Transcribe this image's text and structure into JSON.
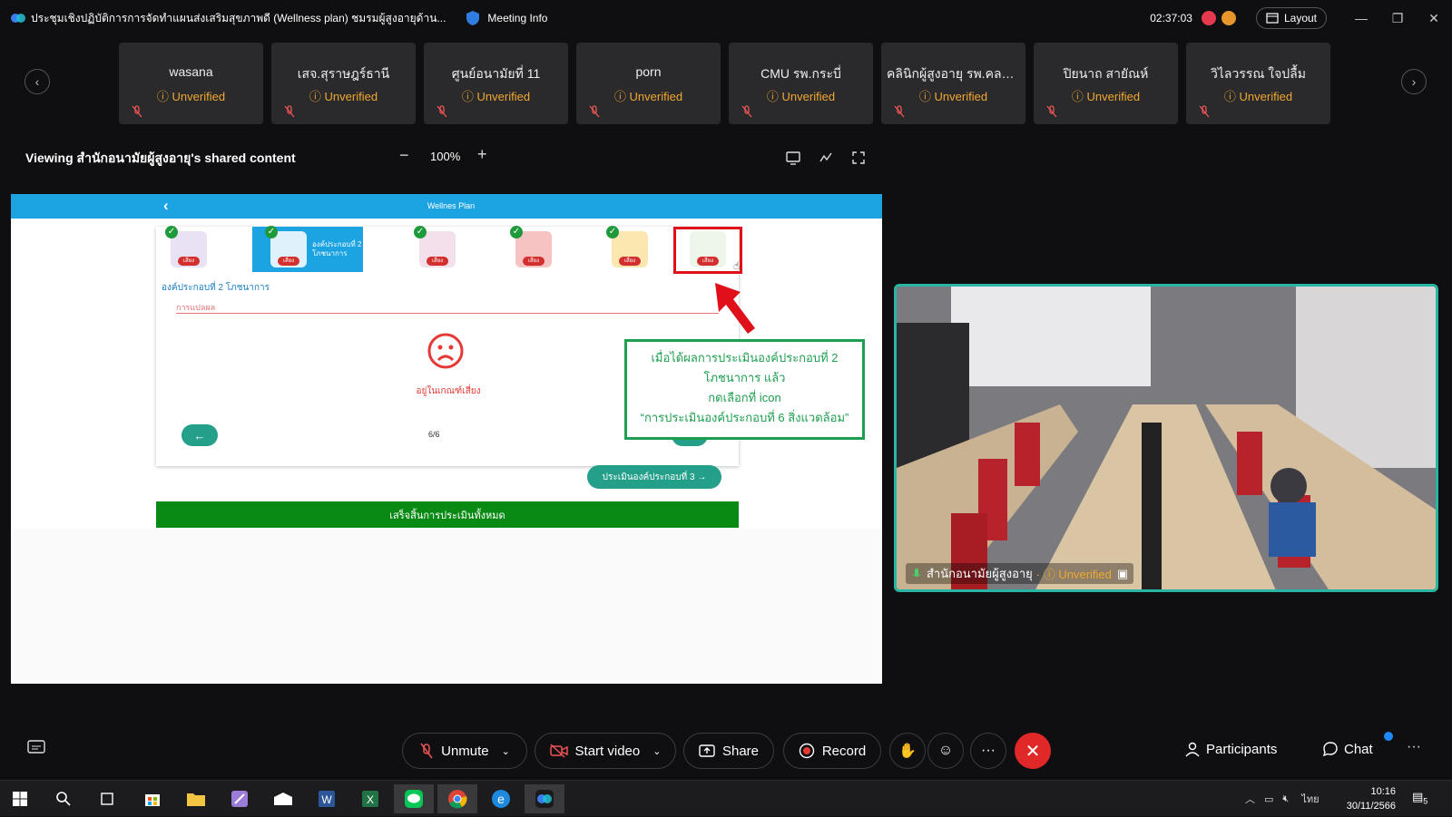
{
  "window": {
    "title": "ประชุมเชิงปฏิบัติการการจัดทำแผนส่งเสริมสุขภาพดี (Wellness plan) ชมรมผู้สูงอายุด้าน...",
    "meeting_info": "Meeting Info",
    "timer": "02:37:03",
    "layout_label": "Layout"
  },
  "participants_strip": [
    {
      "name": "wasana",
      "status": "Unverified"
    },
    {
      "name": "เสจ.สุราษฎร์ธานี",
      "status": "Unverified"
    },
    {
      "name": "ศูนย์อนามัยที่ 11",
      "status": "Unverified"
    },
    {
      "name": "porn",
      "status": "Unverified"
    },
    {
      "name": "CMU รพ.กระบี่",
      "status": "Unverified"
    },
    {
      "name": "คลินิกผู้สูงอายุ รพ.คลอง...",
      "status": "Unverified"
    },
    {
      "name": "ปิยนาถ สายัณห์",
      "status": "Unverified"
    },
    {
      "name": "วิไลวรรณ ใจปลื้ม",
      "status": "Unverified"
    }
  ],
  "viewing": {
    "label": "Viewing สำนักอนามัยผู้สูงอายุ's shared content",
    "zoom": "100%"
  },
  "shared": {
    "header_title": "Wellnes Plan",
    "category_badge": "เสี่ยง",
    "active_category_label": "องค์ประกอบที่ 2 โภชนาการ",
    "section_title": "องค์ประกอบที่ 2 โภชนาการ",
    "input_placeholder": "การแปลผล",
    "result_text": "อยู่ในเกณฑ์เสี่ยง",
    "page": "6/6",
    "next_section_button": "ประเมินองค์ประกอบที่ 3 →",
    "finish_button": "เสร็จสิ้นการประเมินทั้งหมด"
  },
  "annotation": {
    "line1": "เมื่อได้ผลการประเมินองค์ประกอบที่ 2",
    "line2": "โภชนาการ แล้ว",
    "line3": "กดเลือกที่ icon",
    "line4": "“การประเมินองค์ประกอบที่ 6 สิ่งแวดล้อม”"
  },
  "video": {
    "name": "สำนักอนามัยผู้สูงอายุ",
    "status": "Unverified"
  },
  "controls": {
    "unmute": "Unmute",
    "start_video": "Start video",
    "share": "Share",
    "record": "Record",
    "more": "···",
    "participants": "Participants",
    "chat": "Chat"
  },
  "taskbar": {
    "lang": "ไทย",
    "time": "10:16",
    "date": "30/11/2566",
    "notif_count": "5"
  },
  "colors": {
    "accent_blue": "#1ba3e2",
    "teal": "#239f8a",
    "finish_green": "#088a15",
    "annotation_green": "#1e9e50",
    "highlight_red": "#e0101a",
    "unverified": "#f0a830"
  }
}
